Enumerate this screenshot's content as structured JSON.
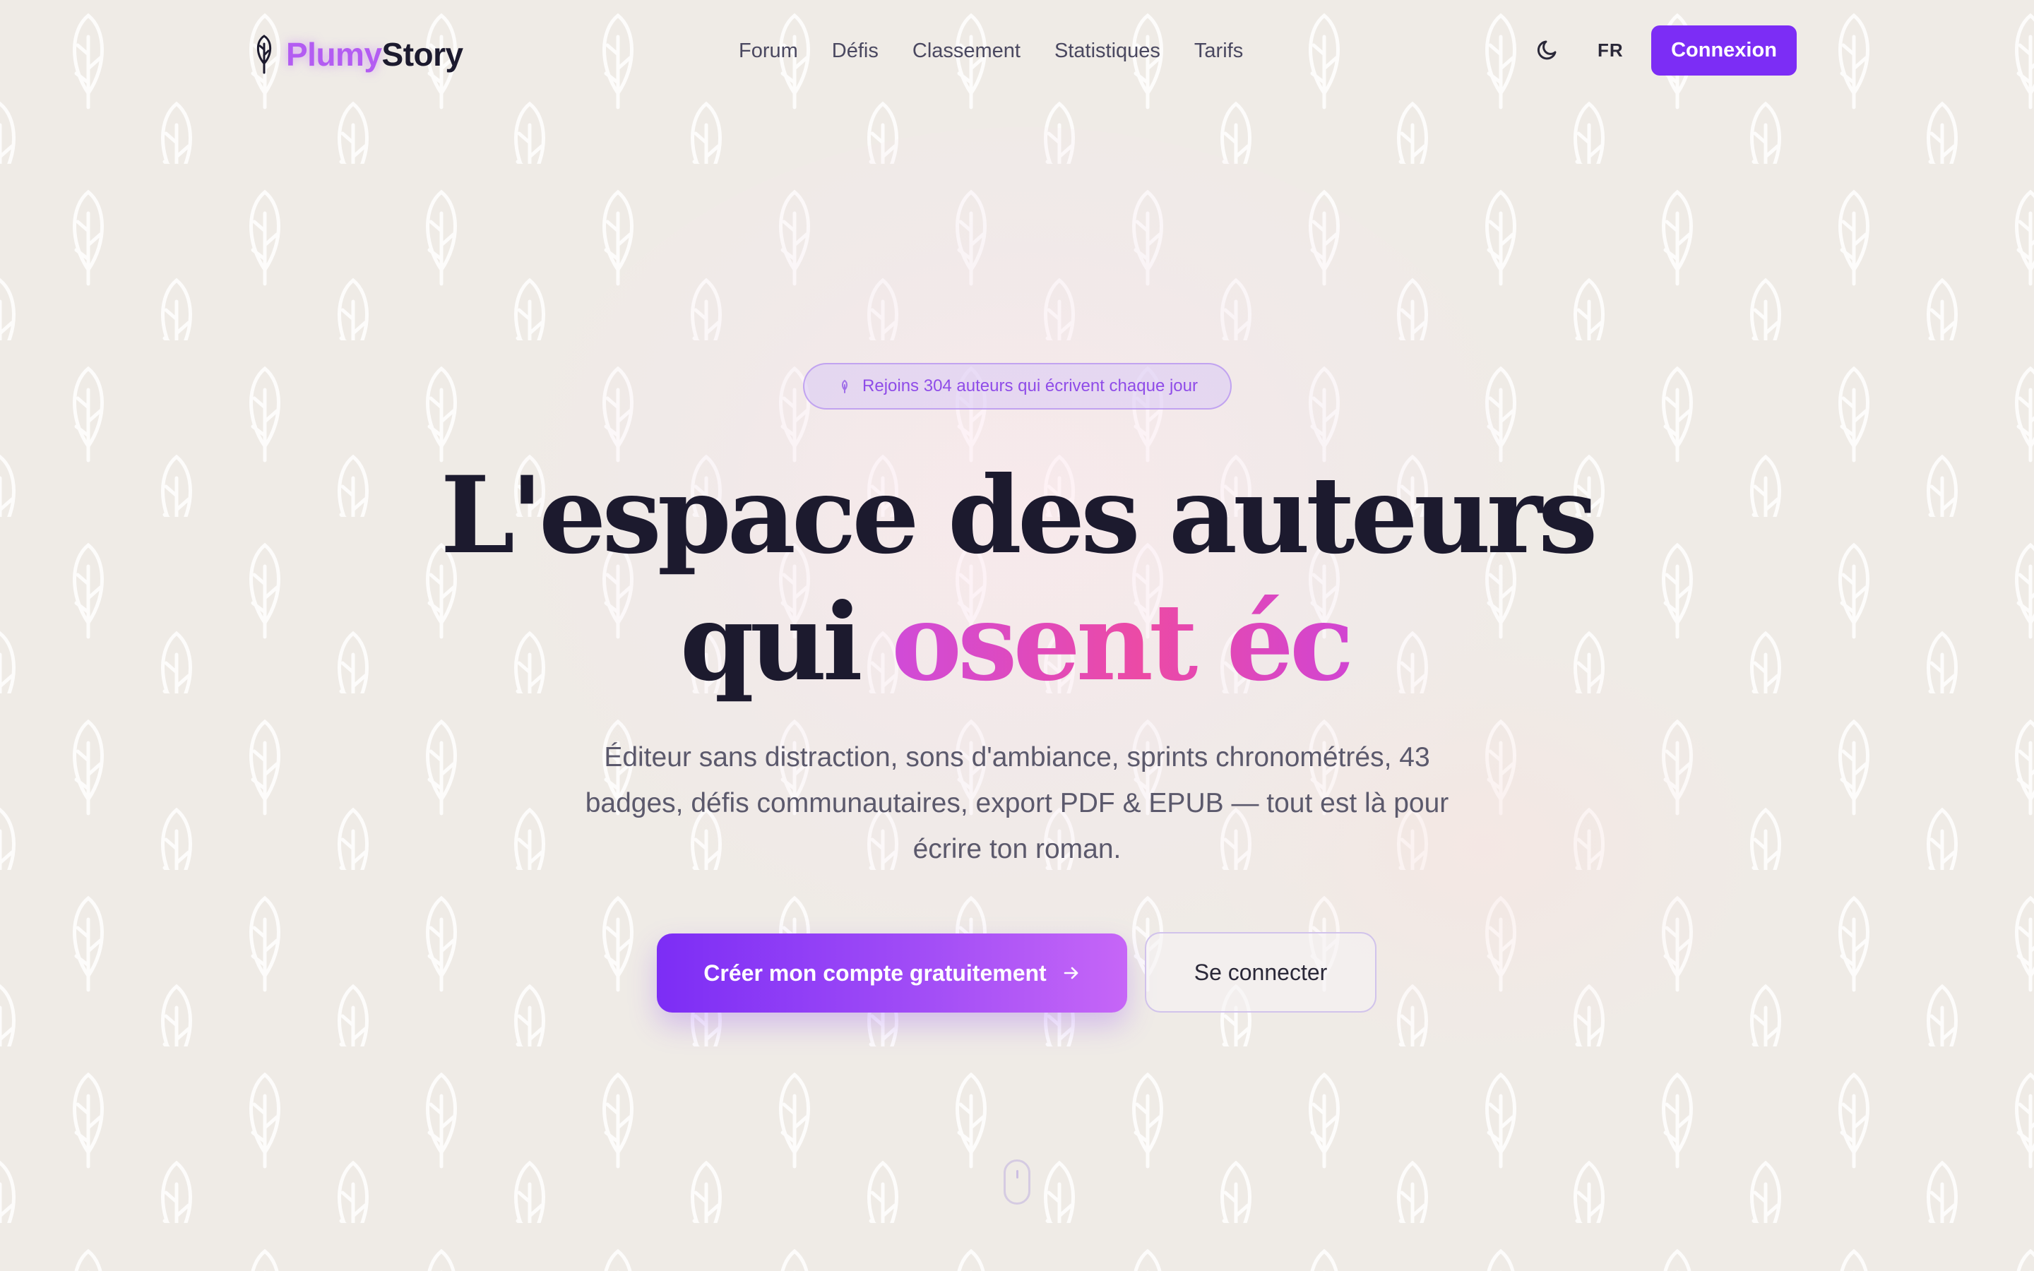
{
  "brand": {
    "name_part1": "Plumy",
    "name_part2": "Story",
    "icon": "feather-logo-icon",
    "accent_color": "#7c2df5",
    "highlight_color": "#ec4aa5"
  },
  "nav": {
    "items": [
      {
        "label": "Forum"
      },
      {
        "label": "Défis"
      },
      {
        "label": "Classement"
      },
      {
        "label": "Statistiques"
      },
      {
        "label": "Tarifs"
      }
    ]
  },
  "header_actions": {
    "theme_icon": "moon-icon",
    "language": "FR",
    "login_label": "Connexion"
  },
  "hero": {
    "badge_icon": "sparkle-icon",
    "badge_text": "Rejoins 304 auteurs qui écrivent chaque jour",
    "title_line1": "L'espace des auteurs",
    "title_line2_plain": "qui",
    "title_line2_highlight": "osent éc",
    "subtitle": "Éditeur sans distraction, sons d'ambiance, sprints chronométrés, 43 badges, défis communautaires, export PDF & EPUB — tout est là pour écrire ton roman.",
    "primary_cta": "Créer mon compte gratuitement",
    "primary_cta_icon": "arrow-right-icon",
    "secondary_cta": "Se connecter",
    "scroll_icon": "mouse-scroll-icon"
  }
}
